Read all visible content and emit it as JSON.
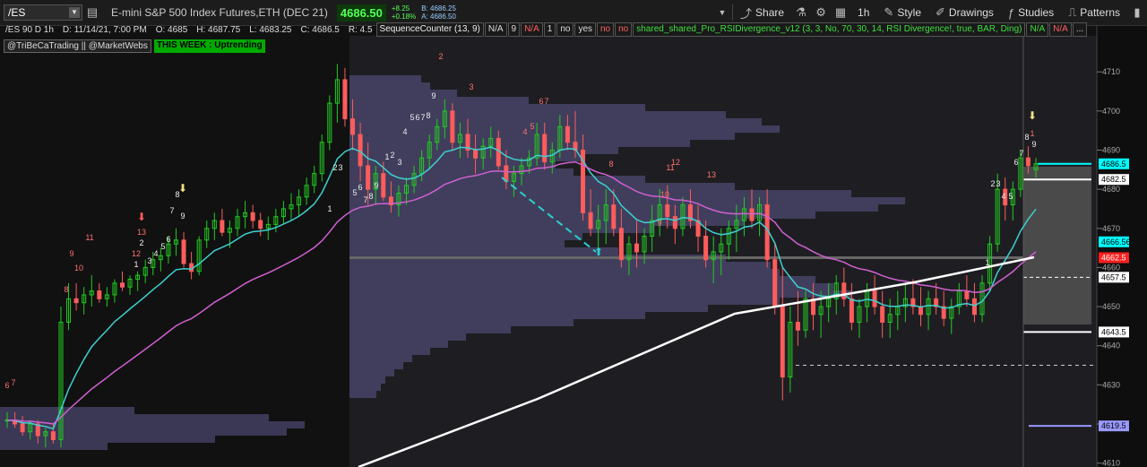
{
  "symbol": "/ES",
  "description": "E-mini S&P 500 Index Futures,ETH (DEC 21)",
  "last_price": "4686.50",
  "net_change": "+8.25",
  "pct_change": "+0.18%",
  "bid": "B: 4686.25",
  "ask": "A: 4686.50",
  "toolbar": {
    "share": "Share",
    "timeframe": "1h",
    "style": "Style",
    "drawings": "Drawings",
    "studies": "Studies",
    "patterns": "Patterns"
  },
  "study": {
    "title": "/ES 90 D 1h",
    "date": "D: 11/14/21, 7:00 PM",
    "open": "O: 4685",
    "high": "H: 4687.75",
    "low": "L: 4683.25",
    "close": "C: 4686.5",
    "range": "R: 4.5",
    "seq": "SequenceCounter (13, 9)",
    "v1": "N/A",
    "v2": "9",
    "v3": "N/A",
    "v4": "1",
    "v5": "no",
    "v6": "yes",
    "v7": "no",
    "v8": "no",
    "rsi": "shared_shared_Pro_RSIDivergence_v12 (3, 3, No, 70, 30, 14, RSI Divergence!, true, BAR, Ding)",
    "v9": "N/A",
    "v10": "N/A",
    "more": "..."
  },
  "label_handles": "@TriBeCaTrading || @MarketWebs",
  "label_week": "THIS WEEK : Uptrending",
  "colors": {
    "up": "#22cc22",
    "down": "#ff5c5c",
    "ema_fast": "#3fd0d0",
    "ema_slow": "#d060d0",
    "sma": "#ffffff",
    "profile": "#5c5a8c"
  },
  "chart_data": {
    "type": "candlestick",
    "yticks": [
      4710,
      4700,
      4690,
      4680,
      4670,
      4660,
      4650,
      4640,
      4630,
      4620,
      4610
    ],
    "ylim": [
      4609,
      4716
    ],
    "price_tags": [
      {
        "value": "4686.5",
        "color": "#00ffff",
        "text": "#000"
      },
      {
        "value": "4682.5",
        "color": "#ffffff",
        "text": "#000"
      },
      {
        "value": "4666.56",
        "color": "#00ffff",
        "text": "#000"
      },
      {
        "value": "4662.5",
        "color": "#ff2020",
        "text": "#fff"
      },
      {
        "value": "4657.5",
        "color": "#ffffff",
        "text": "#000"
      },
      {
        "value": "4643.5",
        "color": "#ffffff",
        "text": "#000"
      },
      {
        "value": "4619.5",
        "color": "#9999ff",
        "text": "#000"
      }
    ],
    "candles": [
      [
        4621,
        4623,
        4619,
        4621
      ],
      [
        4621,
        4623,
        4619,
        4620
      ],
      [
        4620,
        4622,
        4617,
        4618
      ],
      [
        4618,
        4621,
        4616,
        4620
      ],
      [
        4620,
        4621,
        4615,
        4617
      ],
      [
        4617,
        4619,
        4614,
        4618
      ],
      [
        4618,
        4620,
        4615,
        4616
      ],
      [
        4616,
        4650,
        4614,
        4646
      ],
      [
        4646,
        4656,
        4644,
        4652
      ],
      [
        4652,
        4656,
        4649,
        4651
      ],
      [
        4651,
        4655,
        4648,
        4653
      ],
      [
        4653,
        4658,
        4650,
        4654
      ],
      [
        4654,
        4656,
        4651,
        4652
      ],
      [
        4652,
        4655,
        4650,
        4653
      ],
      [
        4653,
        4657,
        4651,
        4656
      ],
      [
        4656,
        4659,
        4654,
        4655
      ],
      [
        4655,
        4658,
        4653,
        4657
      ],
      [
        4657,
        4659,
        4654,
        4658
      ],
      [
        4658,
        4662,
        4656,
        4660
      ],
      [
        4660,
        4664,
        4658,
        4662
      ],
      [
        4662,
        4665,
        4659,
        4663
      ],
      [
        4663,
        4668,
        4661,
        4666
      ],
      [
        4666,
        4670,
        4663,
        4667
      ],
      [
        4667,
        4669,
        4660,
        4661
      ],
      [
        4661,
        4664,
        4657,
        4659
      ],
      [
        4659,
        4668,
        4658,
        4667
      ],
      [
        4667,
        4672,
        4665,
        4670
      ],
      [
        4670,
        4674,
        4667,
        4672
      ],
      [
        4672,
        4675,
        4668,
        4669
      ],
      [
        4669,
        4672,
        4665,
        4670
      ],
      [
        4670,
        4675,
        4668,
        4673
      ],
      [
        4673,
        4677,
        4670,
        4674
      ],
      [
        4674,
        4676,
        4670,
        4672
      ],
      [
        4672,
        4674,
        4668,
        4670
      ],
      [
        4670,
        4673,
        4667,
        4671
      ],
      [
        4671,
        4675,
        4669,
        4673
      ],
      [
        4673,
        4677,
        4671,
        4675
      ],
      [
        4675,
        4679,
        4672,
        4676
      ],
      [
        4676,
        4680,
        4673,
        4678
      ],
      [
        4678,
        4683,
        4676,
        4681
      ],
      [
        4681,
        4686,
        4679,
        4684
      ],
      [
        4684,
        4694,
        4682,
        4692
      ],
      [
        4692,
        4704,
        4690,
        4702
      ],
      [
        4702,
        4712,
        4697,
        4708
      ],
      [
        4708,
        4711,
        4696,
        4698
      ],
      [
        4698,
        4703,
        4690,
        4694
      ],
      [
        4694,
        4697,
        4682,
        4686
      ],
      [
        4686,
        4692,
        4676,
        4680
      ],
      [
        4680,
        4686,
        4676,
        4684
      ],
      [
        4684,
        4687,
        4677,
        4678
      ],
      [
        4678,
        4682,
        4674,
        4676
      ],
      [
        4676,
        4681,
        4673,
        4679
      ],
      [
        4679,
        4683,
        4676,
        4681
      ],
      [
        4681,
        4686,
        4679,
        4684
      ],
      [
        4684,
        4690,
        4682,
        4688
      ],
      [
        4688,
        4694,
        4685,
        4692
      ],
      [
        4692,
        4698,
        4690,
        4696
      ],
      [
        4696,
        4703,
        4693,
        4700
      ],
      [
        4700,
        4702,
        4690,
        4692
      ],
      [
        4692,
        4697,
        4688,
        4694
      ],
      [
        4694,
        4698,
        4688,
        4690
      ],
      [
        4690,
        4694,
        4684,
        4688
      ],
      [
        4688,
        4693,
        4685,
        4691
      ],
      [
        4691,
        4696,
        4688,
        4693
      ],
      [
        4693,
        4695,
        4685,
        4686
      ],
      [
        4686,
        4690,
        4680,
        4682
      ],
      [
        4682,
        4686,
        4678,
        4684
      ],
      [
        4684,
        4688,
        4681,
        4686
      ],
      [
        4686,
        4690,
        4684,
        4688
      ],
      [
        4688,
        4697,
        4686,
        4694
      ],
      [
        4694,
        4697,
        4685,
        4687
      ],
      [
        4687,
        4692,
        4684,
        4690
      ],
      [
        4690,
        4699,
        4688,
        4696
      ],
      [
        4696,
        4699,
        4690,
        4692
      ],
      [
        4692,
        4700,
        4688,
        4690
      ],
      [
        4690,
        4694,
        4672,
        4674
      ],
      [
        4674,
        4680,
        4668,
        4670
      ],
      [
        4670,
        4676,
        4664,
        4672
      ],
      [
        4672,
        4680,
        4666,
        4676
      ],
      [
        4676,
        4680,
        4668,
        4670
      ],
      [
        4670,
        4675,
        4660,
        4662
      ],
      [
        4662,
        4668,
        4658,
        4666
      ],
      [
        4666,
        4672,
        4660,
        4664
      ],
      [
        4664,
        4670,
        4661,
        4668
      ],
      [
        4668,
        4676,
        4664,
        4672
      ],
      [
        4672,
        4680,
        4668,
        4676
      ],
      [
        4676,
        4681,
        4670,
        4673
      ],
      [
        4673,
        4676,
        4666,
        4670
      ],
      [
        4670,
        4678,
        4668,
        4676
      ],
      [
        4676,
        4680,
        4670,
        4672
      ],
      [
        4672,
        4676,
        4664,
        4668
      ],
      [
        4668,
        4672,
        4660,
        4662
      ],
      [
        4662,
        4668,
        4656,
        4664
      ],
      [
        4664,
        4670,
        4658,
        4666
      ],
      [
        4666,
        4672,
        4662,
        4670
      ],
      [
        4670,
        4676,
        4664,
        4672
      ],
      [
        4672,
        4678,
        4668,
        4675
      ],
      [
        4675,
        4680,
        4670,
        4672
      ],
      [
        4672,
        4678,
        4668,
        4676
      ],
      [
        4676,
        4680,
        4660,
        4662
      ],
      [
        4662,
        4666,
        4648,
        4650
      ],
      [
        4650,
        4660,
        4626,
        4632
      ],
      [
        4632,
        4650,
        4628,
        4646
      ],
      [
        4646,
        4654,
        4640,
        4644
      ],
      [
        4644,
        4654,
        4642,
        4652
      ],
      [
        4652,
        4656,
        4644,
        4648
      ],
      [
        4648,
        4654,
        4642,
        4650
      ],
      [
        4650,
        4656,
        4646,
        4652
      ],
      [
        4652,
        4658,
        4648,
        4656
      ],
      [
        4656,
        4660,
        4650,
        4652
      ],
      [
        4652,
        4656,
        4644,
        4646
      ],
      [
        4646,
        4652,
        4642,
        4650
      ],
      [
        4650,
        4656,
        4646,
        4654
      ],
      [
        4654,
        4658,
        4648,
        4650
      ],
      [
        4650,
        4654,
        4642,
        4646
      ],
      [
        4646,
        4652,
        4642,
        4648
      ],
      [
        4648,
        4654,
        4644,
        4650
      ],
      [
        4650,
        4656,
        4646,
        4652
      ],
      [
        4652,
        4657,
        4648,
        4650
      ],
      [
        4650,
        4655,
        4645,
        4648
      ],
      [
        4648,
        4654,
        4644,
        4652
      ],
      [
        4652,
        4656,
        4648,
        4650
      ],
      [
        4650,
        4654,
        4645,
        4647
      ],
      [
        4647,
        4652,
        4643,
        4650
      ],
      [
        4650,
        4656,
        4648,
        4654
      ],
      [
        4654,
        4658,
        4650,
        4652
      ],
      [
        4652,
        4656,
        4646,
        4648
      ],
      [
        4648,
        4658,
        4646,
        4656
      ],
      [
        4656,
        4668,
        4654,
        4666
      ],
      [
        4666,
        4684,
        4664,
        4680
      ],
      [
        4680,
        4683,
        4672,
        4676
      ],
      [
        4676,
        4682,
        4672,
        4680
      ],
      [
        4680,
        4690,
        4678,
        4688
      ],
      [
        4688,
        4691,
        4684,
        4686
      ],
      [
        4685,
        4688,
        4683,
        4686.5
      ]
    ]
  }
}
